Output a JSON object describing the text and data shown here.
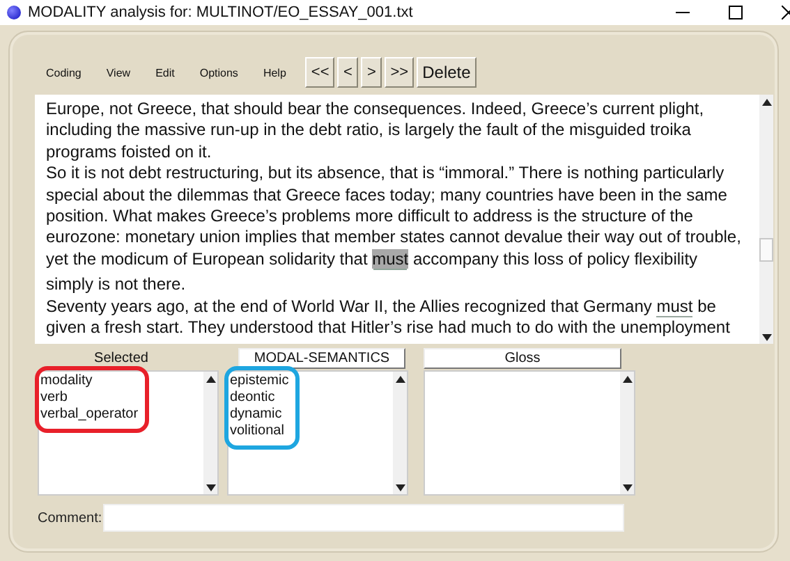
{
  "window": {
    "title": "MODALITY analysis for: MULTINOT/EO_ESSAY_001.txt"
  },
  "menu": [
    "Coding",
    "View",
    "Edit",
    "Options",
    "Help"
  ],
  "nav_buttons": [
    "<<",
    "<",
    ">",
    ">>",
    "Delete"
  ],
  "text_lines": [
    [
      {
        "kind": "plain",
        "text": "Europe, not Greece, that should bear the consequences. Indeed, Greece’s current plight,"
      }
    ],
    [
      {
        "kind": "plain",
        "text": "including the massive run-up in the debt ratio, is largely the fault of the misguided troika"
      }
    ],
    [
      {
        "kind": "plain",
        "text": "programs foisted on it."
      }
    ],
    [
      {
        "kind": "plain",
        "text": "So it is not debt restructuring, but its absence, that is “immoral.” There is nothing particularly"
      }
    ],
    [
      {
        "kind": "plain",
        "text": "special about the dilemmas that Greece faces today; many countries have been in the same"
      }
    ],
    [
      {
        "kind": "plain",
        "text": "position. What makes Greece’s problems more difficult to address is the structure of the"
      }
    ],
    [
      {
        "kind": "plain",
        "text": "eurozone: monetary union implies that member states cannot devalue their way out of trouble,"
      }
    ],
    [
      {
        "kind": "plain",
        "text": "yet the modicum of European solidarity that "
      },
      {
        "kind": "current",
        "text": "must"
      },
      {
        "kind": "plain",
        "text": " accompany this loss of policy flexibility"
      }
    ],
    [
      {
        "kind": "plain",
        "text": "simply is not there."
      }
    ],
    [
      {
        "kind": "plain",
        "text": "Seventy years ago, at the end of World War II, the Allies recognized that Germany "
      },
      {
        "kind": "coded",
        "text": "must"
      },
      {
        "kind": "plain",
        "text": " be"
      }
    ],
    [
      {
        "kind": "plain",
        "text": "given a fresh start. They understood that Hitler’s rise had much to do with the unemployment"
      }
    ]
  ],
  "panels": [
    {
      "kind": "label",
      "header": "Selected",
      "items": [
        "modality",
        "verb",
        "verbal_operator"
      ],
      "color": "#e8202a"
    },
    {
      "kind": "button",
      "header": "MODAL-SEMANTICS",
      "items": [
        "epistemic",
        "deontic",
        "dynamic",
        "volitional"
      ],
      "color": "#1ea6e0"
    },
    {
      "kind": "button",
      "header": "Gloss"
    }
  ],
  "comment": {
    "label": "Comment:"
  }
}
